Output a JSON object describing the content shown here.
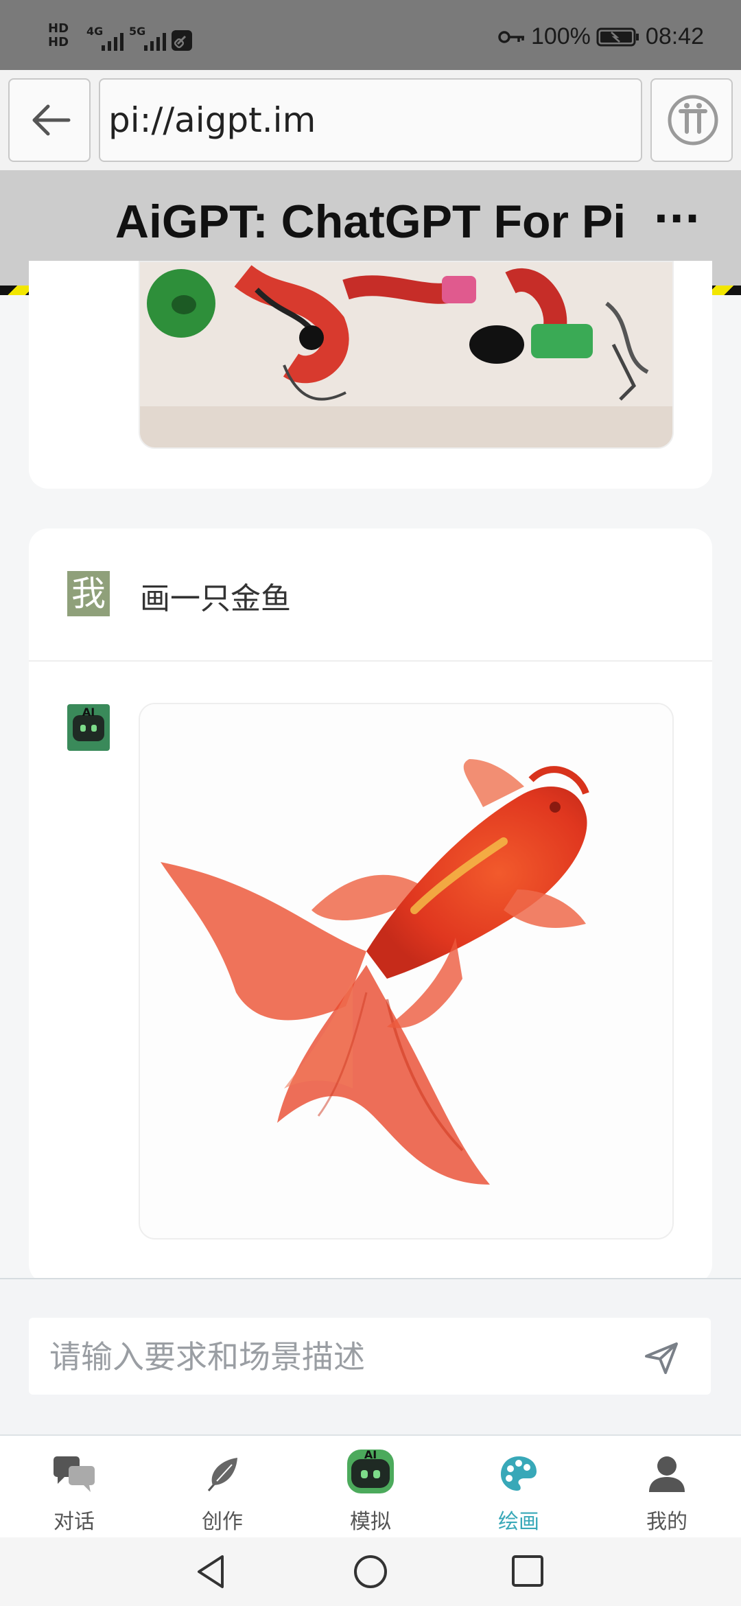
{
  "status_bar": {
    "left_badges": [
      "HD",
      "HD"
    ],
    "network_4g": "4G",
    "network_5g": "5G",
    "battery": "100%",
    "time": "08:42",
    "icons": [
      "hd-badge-icon",
      "signal-icon",
      "link-icon",
      "key-icon",
      "battery-charging-icon"
    ]
  },
  "browser": {
    "url": "pi://aigpt.im",
    "back_icon": "arrow-left-icon",
    "pi_icon": "pi-logo-icon"
  },
  "header": {
    "title": "AiGPT: ChatGPT For Pi",
    "more_label": "···"
  },
  "chat": {
    "user_avatar_label": "我",
    "user_message": "画一只金鱼",
    "ai_avatar_label": "AI"
  },
  "input": {
    "placeholder": "请输入要求和场景描述",
    "send_icon": "send-icon"
  },
  "nav": {
    "items": [
      {
        "label": "对话",
        "icon": "chat-bubbles-icon"
      },
      {
        "label": "创作",
        "icon": "feather-icon"
      },
      {
        "label": "模拟",
        "icon": "robot-icon"
      },
      {
        "label": "绘画",
        "icon": "palette-icon"
      },
      {
        "label": "我的",
        "icon": "user-icon"
      }
    ],
    "active": "绘画"
  },
  "colors": {
    "accent": "#38a8b8",
    "status_bar": "#7a7a7a",
    "header": "#cccccc",
    "goldfish": "#e8472a"
  }
}
